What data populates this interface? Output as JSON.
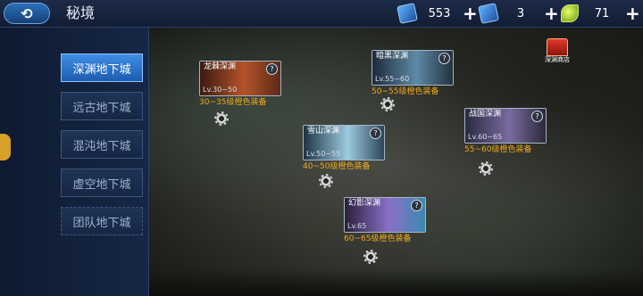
{
  "header": {
    "title": "秘境",
    "back_icon": "back-arrow-icon",
    "resources": [
      {
        "icon": "blue-ticket-icon",
        "value": "553"
      },
      {
        "icon": "blue-ticket-icon",
        "value": "3"
      },
      {
        "icon": "green-leaf-icon",
        "value": "71"
      }
    ]
  },
  "sidebar": {
    "items": [
      {
        "label": "深渊地下城",
        "active": true
      },
      {
        "label": "远古地下城"
      },
      {
        "label": "混沌地下城"
      },
      {
        "label": "虚空地下城"
      },
      {
        "label": "团队地下城"
      }
    ]
  },
  "shop": {
    "label": "深渊商店"
  },
  "dungeons": [
    {
      "name": "龙棘深渊",
      "level": "Lv.30~50",
      "reward": "30~35级橙色装备"
    },
    {
      "name": "暗黑深渊",
      "level": "Lv.55~60",
      "reward": "50~55级橙色装备"
    },
    {
      "name": "雪山深渊",
      "level": "Lv.50~55",
      "reward": "40~50级橙色装备"
    },
    {
      "name": "战国深渊",
      "level": "Lv.60~65",
      "reward": "55~60级橙色装备"
    },
    {
      "name": "幻影深渊",
      "level": "Lv.65",
      "reward": "60~65级橙色装备"
    }
  ],
  "colors": {
    "accent": "#3f8ee6",
    "reward": "#f0a81e"
  }
}
